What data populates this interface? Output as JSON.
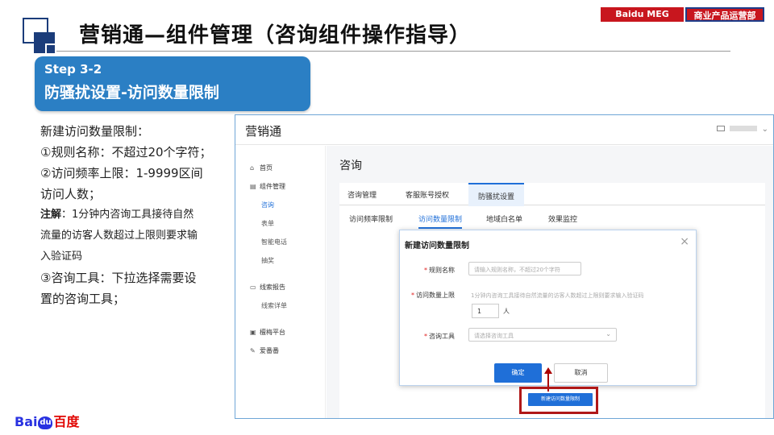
{
  "slide": {
    "title": "营销通—组件管理（咨询组件操作指导）",
    "brand_tag_1": "Baidu MEG",
    "brand_tag_2": "商业产品运营部",
    "step_no": "Step 3-2",
    "step_title": "防骚扰设置-访问数量限制",
    "desc": [
      "新建访问数量限制：",
      "①规则名称：不超过20个字符；",
      "②访问频率上限：1-9999区间",
      "访问人数；"
    ],
    "note_label": "注解",
    "note_text": "：1分钟内咨询工具接待自然",
    "note_lines": [
      "流量的访客人数超过上限则要求输",
      "入验证码"
    ],
    "desc2": [
      "③咨询工具：下拉选择需要设",
      "置的咨询工具；"
    ],
    "logo_left": "Bai",
    "logo_paw": "du",
    "logo_right": "百度"
  },
  "app": {
    "name": "营销通",
    "nav": {
      "home": "首页",
      "component_mgmt": "组件管理",
      "consult": "咨询",
      "form": "表单",
      "smart_phone": "智能电话",
      "lottery": "抽奖",
      "clue_report": "线索报告",
      "clue_detail": "线索详单",
      "platform": "檀梅平台",
      "aifanfan": "爱番番"
    },
    "page_title": "咨询",
    "tabs": [
      "咨询管理",
      "客服账号授权",
      "防骚扰设置"
    ],
    "subtabs": [
      "访问频率限制",
      "访问数量限制",
      "地域白名单",
      "效果监控"
    ],
    "new_button": "新建访问数量限制"
  },
  "dialog": {
    "title": "新建访问数量限制",
    "close": "×",
    "rule_label": "规则名称",
    "rule_placeholder": "请输入规则名称，不超过20个字符",
    "limit_label": "访问数量上限",
    "limit_hint": "1分钟内咨询工具接待自然流量的访客人数超过上限则要求输入验证码",
    "limit_value": "1",
    "limit_unit": "人",
    "tool_label": "咨询工具",
    "tool_placeholder": "请选择咨询工具",
    "ok": "确定",
    "cancel": "取消"
  }
}
